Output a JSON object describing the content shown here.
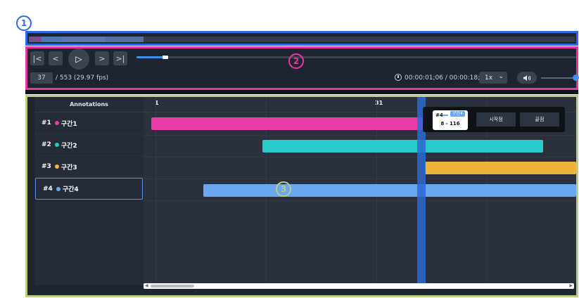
{
  "badges": {
    "one": "1",
    "two": "2",
    "three": "3"
  },
  "player": {
    "first_label": "|<",
    "prev_label": "<",
    "play_label": "▷",
    "next_label": ">",
    "last_label": ">|",
    "current_frame": "37",
    "frame_total": "/ 553 (29.97 fps)",
    "timecode": "00:00:01;06 / 00:00:18;12",
    "speed": "1x",
    "volume_icon": "speaker-icon",
    "seek_progress": 0.066
  },
  "annotations": {
    "header": "Annotations",
    "items": [
      {
        "id": "#1",
        "label": "구간1",
        "color": "#e83aa8"
      },
      {
        "id": "#2",
        "label": "구간2",
        "color": "#27c9c9"
      },
      {
        "id": "#3",
        "label": "구간3",
        "color": "#f0b43c"
      },
      {
        "id": "#4",
        "label": "구간4",
        "color": "#6aa7f0"
      }
    ]
  },
  "timeline": {
    "tick_1": "1",
    "tick_31": "31"
  },
  "popup": {
    "id": "#4",
    "chip": "구간4",
    "range": "8 - 116",
    "start_button": "시작점",
    "end_button": "끝점"
  },
  "colors": {
    "accent": "#3d8ff2",
    "section1_border": "#2e6ae6",
    "section2_border": "#e23a9c",
    "section3_border": "#b7cf7d"
  }
}
